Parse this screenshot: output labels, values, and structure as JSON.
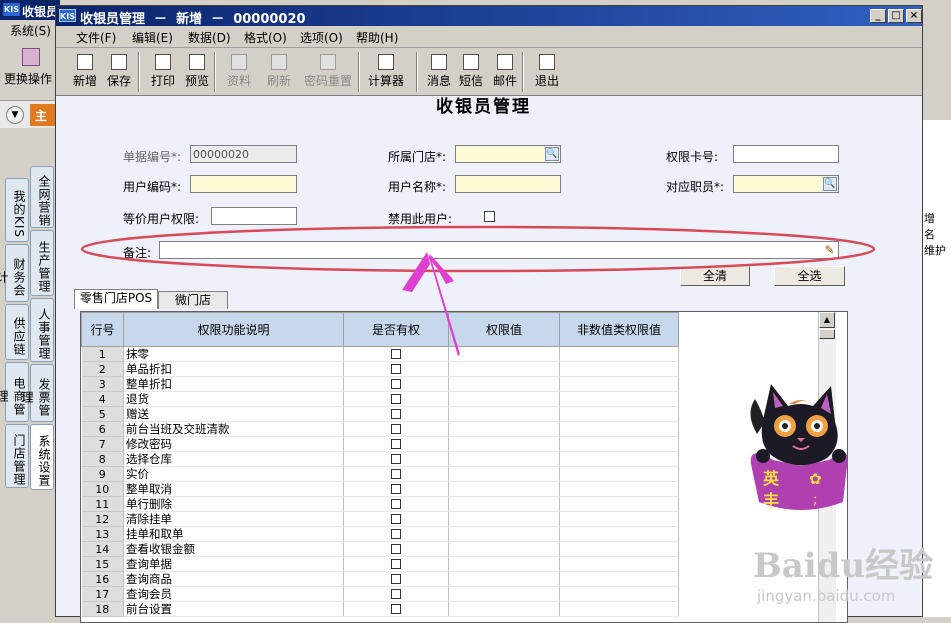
{
  "bg_app": {
    "title": "收银员",
    "logo": "KIS",
    "menu": "系统(S)",
    "switch_op": "更换操作",
    "orange_tab": "主",
    "right_items": [
      "增",
      "名",
      "维护"
    ]
  },
  "side_tabs_left": [
    "我的KIS",
    "财务会计",
    "供应链",
    "电商管理",
    "门店管理"
  ],
  "side_tabs_right": [
    "全网营销",
    "生产管理",
    "人事管理",
    "发票管理",
    "系统设置"
  ],
  "window": {
    "logo": "KIS",
    "title": "收银员管理  －  新增  －  00000020",
    "controls": [
      "_",
      "□",
      "×"
    ]
  },
  "menu": [
    "文件(F)",
    "编辑(E)",
    "数据(D)",
    "格式(O)",
    "选项(O)",
    "帮助(H)"
  ],
  "toolbar": [
    {
      "label": "新增",
      "icon": "new-file-icon",
      "enabled": true
    },
    {
      "label": "保存",
      "icon": "save-icon",
      "enabled": true
    },
    {
      "label": "打印",
      "icon": "print-icon",
      "enabled": true
    },
    {
      "label": "预览",
      "icon": "preview-icon",
      "enabled": true
    },
    {
      "label": "资料",
      "icon": "data-icon",
      "enabled": false
    },
    {
      "label": "刷新",
      "icon": "refresh-icon",
      "enabled": false
    },
    {
      "label": "密码重置",
      "icon": "password-reset-icon",
      "enabled": false
    },
    {
      "label": "计算器",
      "icon": "calculator-icon",
      "enabled": true
    },
    {
      "label": "消息",
      "icon": "message-icon",
      "enabled": true
    },
    {
      "label": "短信",
      "icon": "sms-icon",
      "enabled": true
    },
    {
      "label": "邮件",
      "icon": "mail-icon",
      "enabled": true
    },
    {
      "label": "退出",
      "icon": "exit-icon",
      "enabled": true
    }
  ],
  "form": {
    "title": "收银员管理",
    "doc_no_label": "单据编号*:",
    "doc_no_value": "00000020",
    "store_label": "所属门店*:",
    "card_label": "权限卡号:",
    "user_code_label": "用户编码*:",
    "user_name_label": "用户名称*:",
    "staff_label": "对应职员*:",
    "same_perm_label": "等价用户权限:",
    "disable_label": "禁用此用户:",
    "remark_label": "备注:",
    "clear_all": "全清",
    "select_all": "全选"
  },
  "tabs": [
    "零售门店POS",
    "微门店"
  ],
  "grid": {
    "headers": [
      "行号",
      "权限功能说明",
      "是否有权",
      "权限值",
      "非数值类权限值"
    ],
    "rows": [
      {
        "no": "1",
        "desc": "抹零"
      },
      {
        "no": "2",
        "desc": "单品折扣"
      },
      {
        "no": "3",
        "desc": "整单折扣"
      },
      {
        "no": "4",
        "desc": "退货"
      },
      {
        "no": "5",
        "desc": "赠送"
      },
      {
        "no": "6",
        "desc": "前台当班及交班清款"
      },
      {
        "no": "7",
        "desc": "修改密码"
      },
      {
        "no": "8",
        "desc": "选择仓库"
      },
      {
        "no": "9",
        "desc": "实价"
      },
      {
        "no": "10",
        "desc": "整单取消"
      },
      {
        "no": "11",
        "desc": "单行删除"
      },
      {
        "no": "12",
        "desc": "清除挂单"
      },
      {
        "no": "13",
        "desc": "挂单和取单"
      },
      {
        "no": "14",
        "desc": "查看收银金额"
      },
      {
        "no": "15",
        "desc": "查询单据"
      },
      {
        "no": "16",
        "desc": "查询商品"
      },
      {
        "no": "17",
        "desc": "查询会员"
      },
      {
        "no": "18",
        "desc": "前台设置"
      }
    ]
  },
  "mascot_text": [
    "英",
    "丰"
  ],
  "watermark": {
    "line1": "Baidu经验",
    "line2": "jingyan.baidu.com"
  },
  "colors": {
    "highlight_ellipse": "#d84a5a",
    "arrow": "#e040d0",
    "required_field": "#fffbd8",
    "title_bar": "#0a246a",
    "mascot_purple": "#b040b0"
  }
}
